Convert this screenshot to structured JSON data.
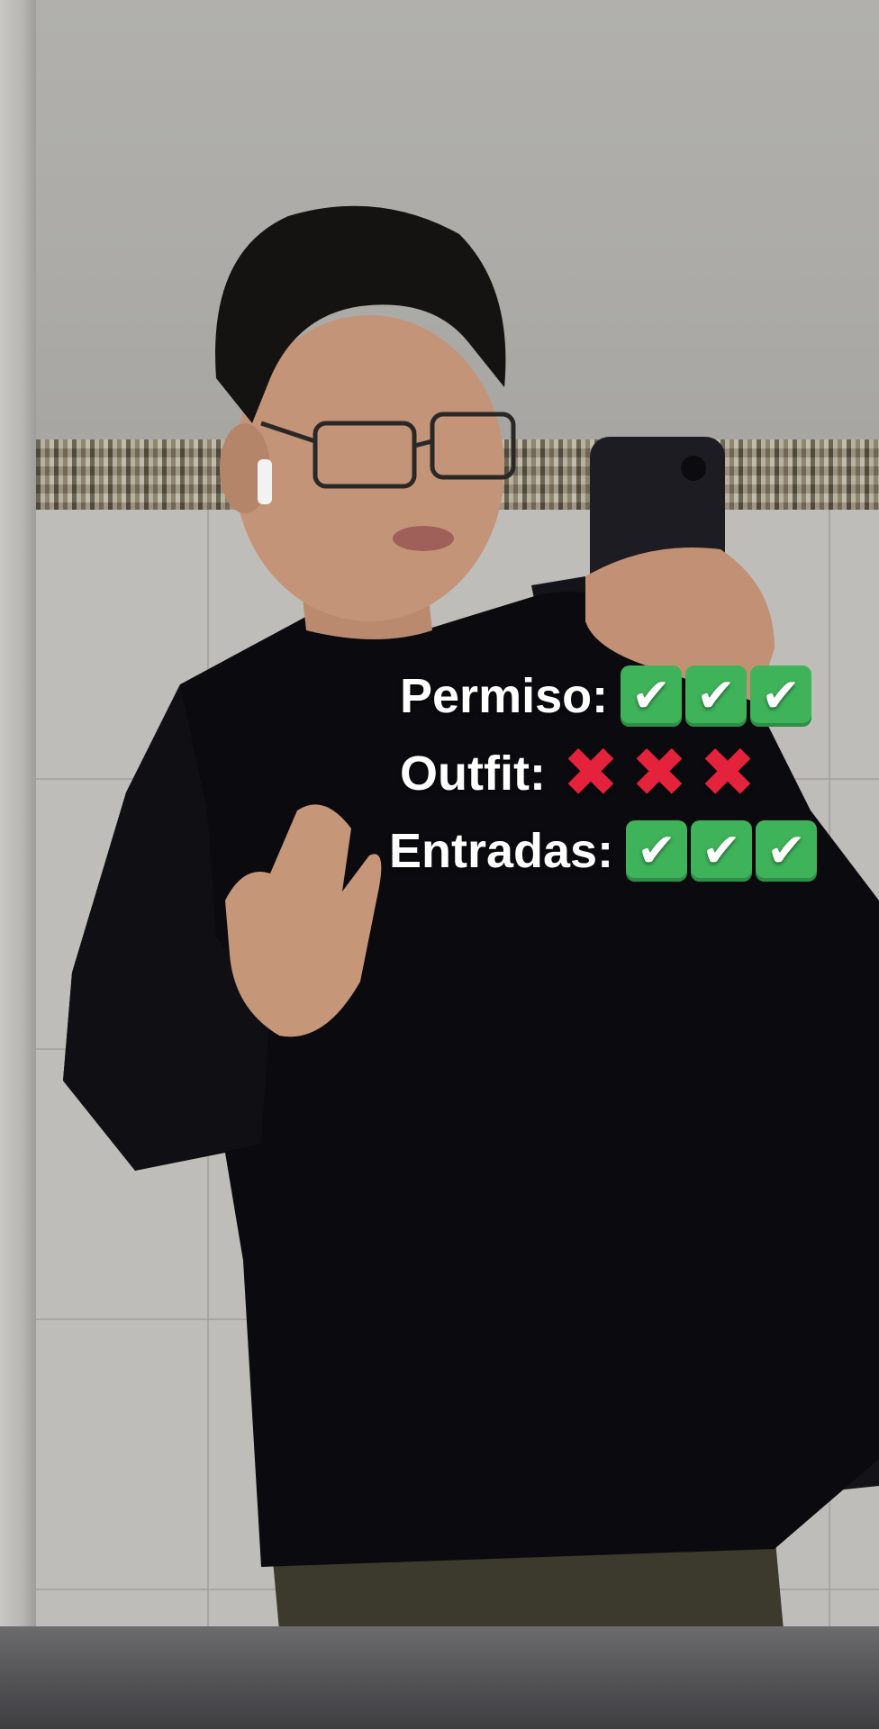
{
  "overlay": {
    "lines": [
      {
        "label": "Permiso:",
        "marks": [
          "check",
          "check",
          "check"
        ]
      },
      {
        "label": "Outfit:",
        "marks": [
          "cross",
          "cross",
          "cross"
        ]
      },
      {
        "label": "Entradas:",
        "marks": [
          "check",
          "check",
          "check"
        ]
      }
    ],
    "glyphs": {
      "check": "✔",
      "cross": "✖"
    },
    "colors": {
      "check_bg": "#3fb35a",
      "cross": "#e4223b",
      "text": "#ffffff"
    }
  }
}
